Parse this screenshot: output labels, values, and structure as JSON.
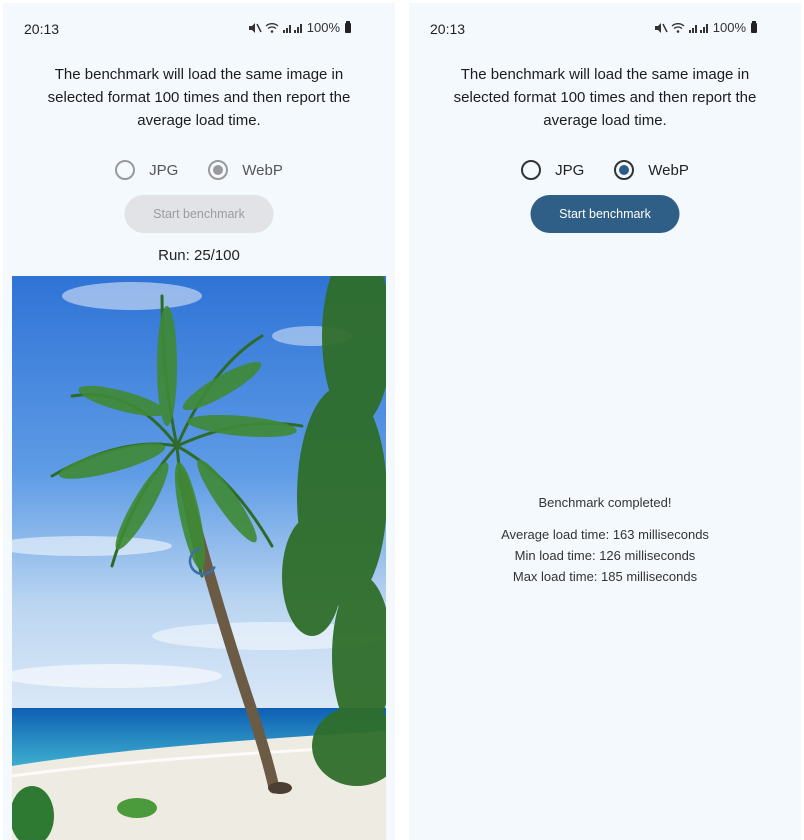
{
  "left_screen": {
    "status_bar": {
      "time": "20:13",
      "battery": "100%"
    },
    "intro": "The benchmark will load the same image in selected format 100 times and then report the average load time.",
    "formats": [
      {
        "label": "JPG",
        "checked": false
      },
      {
        "label": "WebP",
        "checked": true
      }
    ],
    "start_button": "Start benchmark",
    "start_button_enabled": false,
    "run_status": "Run: 25/100",
    "loading_spinner": true
  },
  "right_screen": {
    "status_bar": {
      "time": "20:13",
      "battery": "100%"
    },
    "intro": "The benchmark will load the same image in selected format 100 times and then report the average load time.",
    "formats": [
      {
        "label": "JPG",
        "checked": false
      },
      {
        "label": "WebP",
        "checked": true
      }
    ],
    "start_button": "Start benchmark",
    "start_button_enabled": true,
    "results": {
      "completed": "Benchmark completed!",
      "average": "Average load time: 163 milliseconds",
      "min": "Min load time: 126 milliseconds",
      "max": "Max load time: 185 milliseconds"
    }
  },
  "colors": {
    "screen_background": "#f4f9fe",
    "button_enabled": "#2f5f86",
    "button_disabled": "#e2e3e6",
    "radio_selected_enabled": "#2a5c8a",
    "radio_selected_disabled": "#9a9a9a"
  },
  "icons": [
    "mute-icon",
    "wifi-icon",
    "signal-icon",
    "battery-icon"
  ]
}
